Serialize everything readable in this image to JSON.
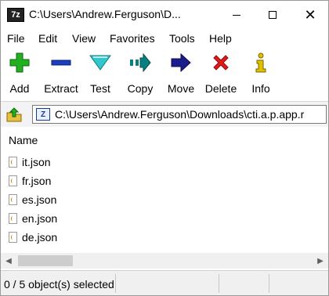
{
  "window": {
    "title": "C:\\Users\\Andrew.Ferguson\\D...",
    "app_icon_text": "7z"
  },
  "menu": [
    "File",
    "Edit",
    "View",
    "Favorites",
    "Tools",
    "Help"
  ],
  "toolbar": [
    {
      "label": "Add",
      "icon": "add-icon"
    },
    {
      "label": "Extract",
      "icon": "extract-icon"
    },
    {
      "label": "Test",
      "icon": "test-icon"
    },
    {
      "label": "Copy",
      "icon": "copy-icon"
    },
    {
      "label": "Move",
      "icon": "move-icon"
    },
    {
      "label": "Delete",
      "icon": "delete-icon"
    },
    {
      "label": "Info",
      "icon": "info-icon"
    }
  ],
  "address": {
    "path": "C:\\Users\\Andrew.Ferguson\\Downloads\\cti.a.p.app.r"
  },
  "list": {
    "column_header": "Name",
    "files": [
      "it.json",
      "fr.json",
      "es.json",
      "en.json",
      "de.json"
    ]
  },
  "status": {
    "text": "0 / 5 object(s) selected"
  },
  "colors": {
    "add": "#22b022",
    "extract": "#1a3fc0",
    "test": "#33c6cc",
    "copy": "#0a7f7f",
    "move": "#1b1e8a",
    "delete": "#e01b1b",
    "info": "#e0c000"
  }
}
